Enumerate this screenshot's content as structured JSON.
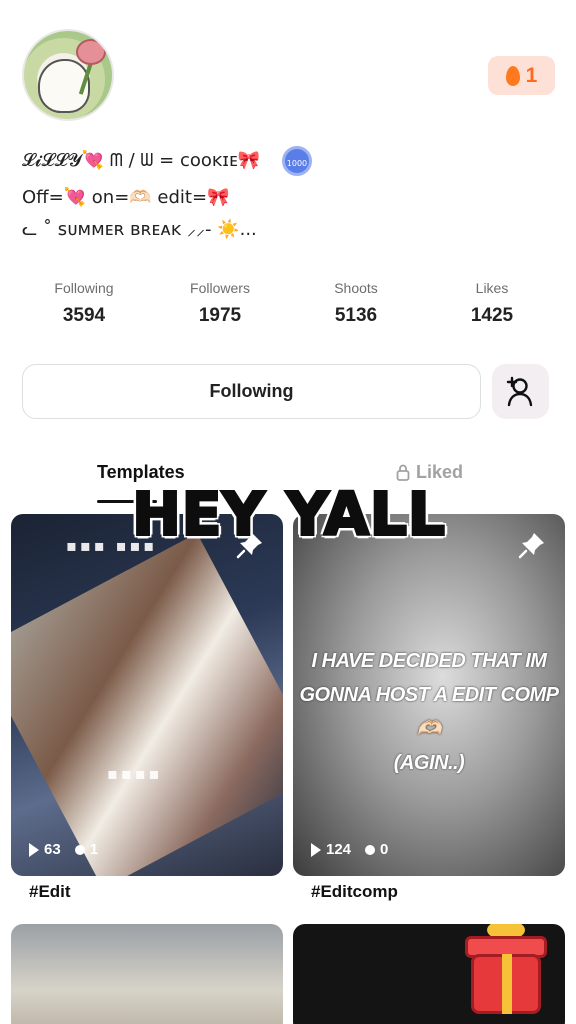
{
  "profile": {
    "bio_line1": "𝓛𝓲𝓛𝓛𝓨💘 ᗰ / ᗯ = ᴄᴏᴏᴋɪᴇ🎀",
    "badge": "1000",
    "bio_line2": "Off=💘 on=🫶🏻 edit=🎀",
    "bio_line3": "ᓚ ˚ ꜱᴜᴍᴍᴇʀ ʙʀᴇᴀᴋ ⸝⸝- ☀️...",
    "streak_count": "1"
  },
  "stats": [
    {
      "label": "Following",
      "value": "3594"
    },
    {
      "label": "Followers",
      "value": "1975"
    },
    {
      "label": "Shoots",
      "value": "5136"
    },
    {
      "label": "Likes",
      "value": "1425"
    }
  ],
  "actions": {
    "follow_label": "Following"
  },
  "tabs": {
    "templates": "Templates",
    "liked": "Liked"
  },
  "overlay_sticker": "HEY YALL",
  "cards": [
    {
      "views": "63",
      "comments": "1",
      "tag": "#Edit"
    },
    {
      "views": "124",
      "comments": "0",
      "tag": "#Editcomp",
      "caption_lines": [
        "I HAVE DECIDED THAT IM",
        "GONNA HOST A EDIT COMP🫶🏻",
        "(AGIN..)"
      ]
    }
  ],
  "colors": {
    "accent_streak": "#ff6a1f",
    "tab_inactive": "#a2a2a2"
  }
}
